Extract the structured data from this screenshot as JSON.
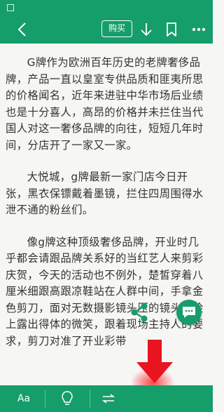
{
  "toolbar": {
    "back_icon": "chevron-left-icon",
    "buy_label": "购买",
    "download_icon": "download-arrow-icon",
    "bookmark_icon": "bookmark-icon",
    "more_icon": "more-dots-icon"
  },
  "article": {
    "paragraphs": [
      "G牌作为欧洲百年历史的老牌奢侈品牌，产品一直以皇室专供品质和匪夷所思的价格闻名，近年来进驻中华市场后业绩也是十分喜人，高昂的价格并未拦住当代国人对这一奢侈品牌的向往，短短几年时间，分店开了一家又一家。",
      "大悦城，g牌最新一家门店今日开张，黑衣保镖戴着墨镜，拦住四周围得水泄不通的粉丝们。",
      "像g牌这种顶级奢侈品牌，开业时几乎都会请跟品牌关系好的当红艺人来剪彩庆贺，今天的活动也不例外，楚皙穿着八厘米细跟高跟凉鞋站在人群中间，手拿金色剪刀，面对无数摄影镜头压的镜头，脸上露出得体的微笑，跟着现场主持人的要求，剪刀对准了开业彩带"
    ]
  },
  "bottom_bar": {
    "font_label": "Aa",
    "light_icon": "lightbulb-icon",
    "switch_icon": "swap-arrows-icon"
  },
  "floating": {
    "share_icon": "share-icon",
    "comment_icon": "comment-bubble-icon"
  },
  "colors": {
    "brand_green": "#159d6a",
    "text": "#333333",
    "page_bg": "#f6f6f4",
    "annotation_red": "#e8141e"
  }
}
